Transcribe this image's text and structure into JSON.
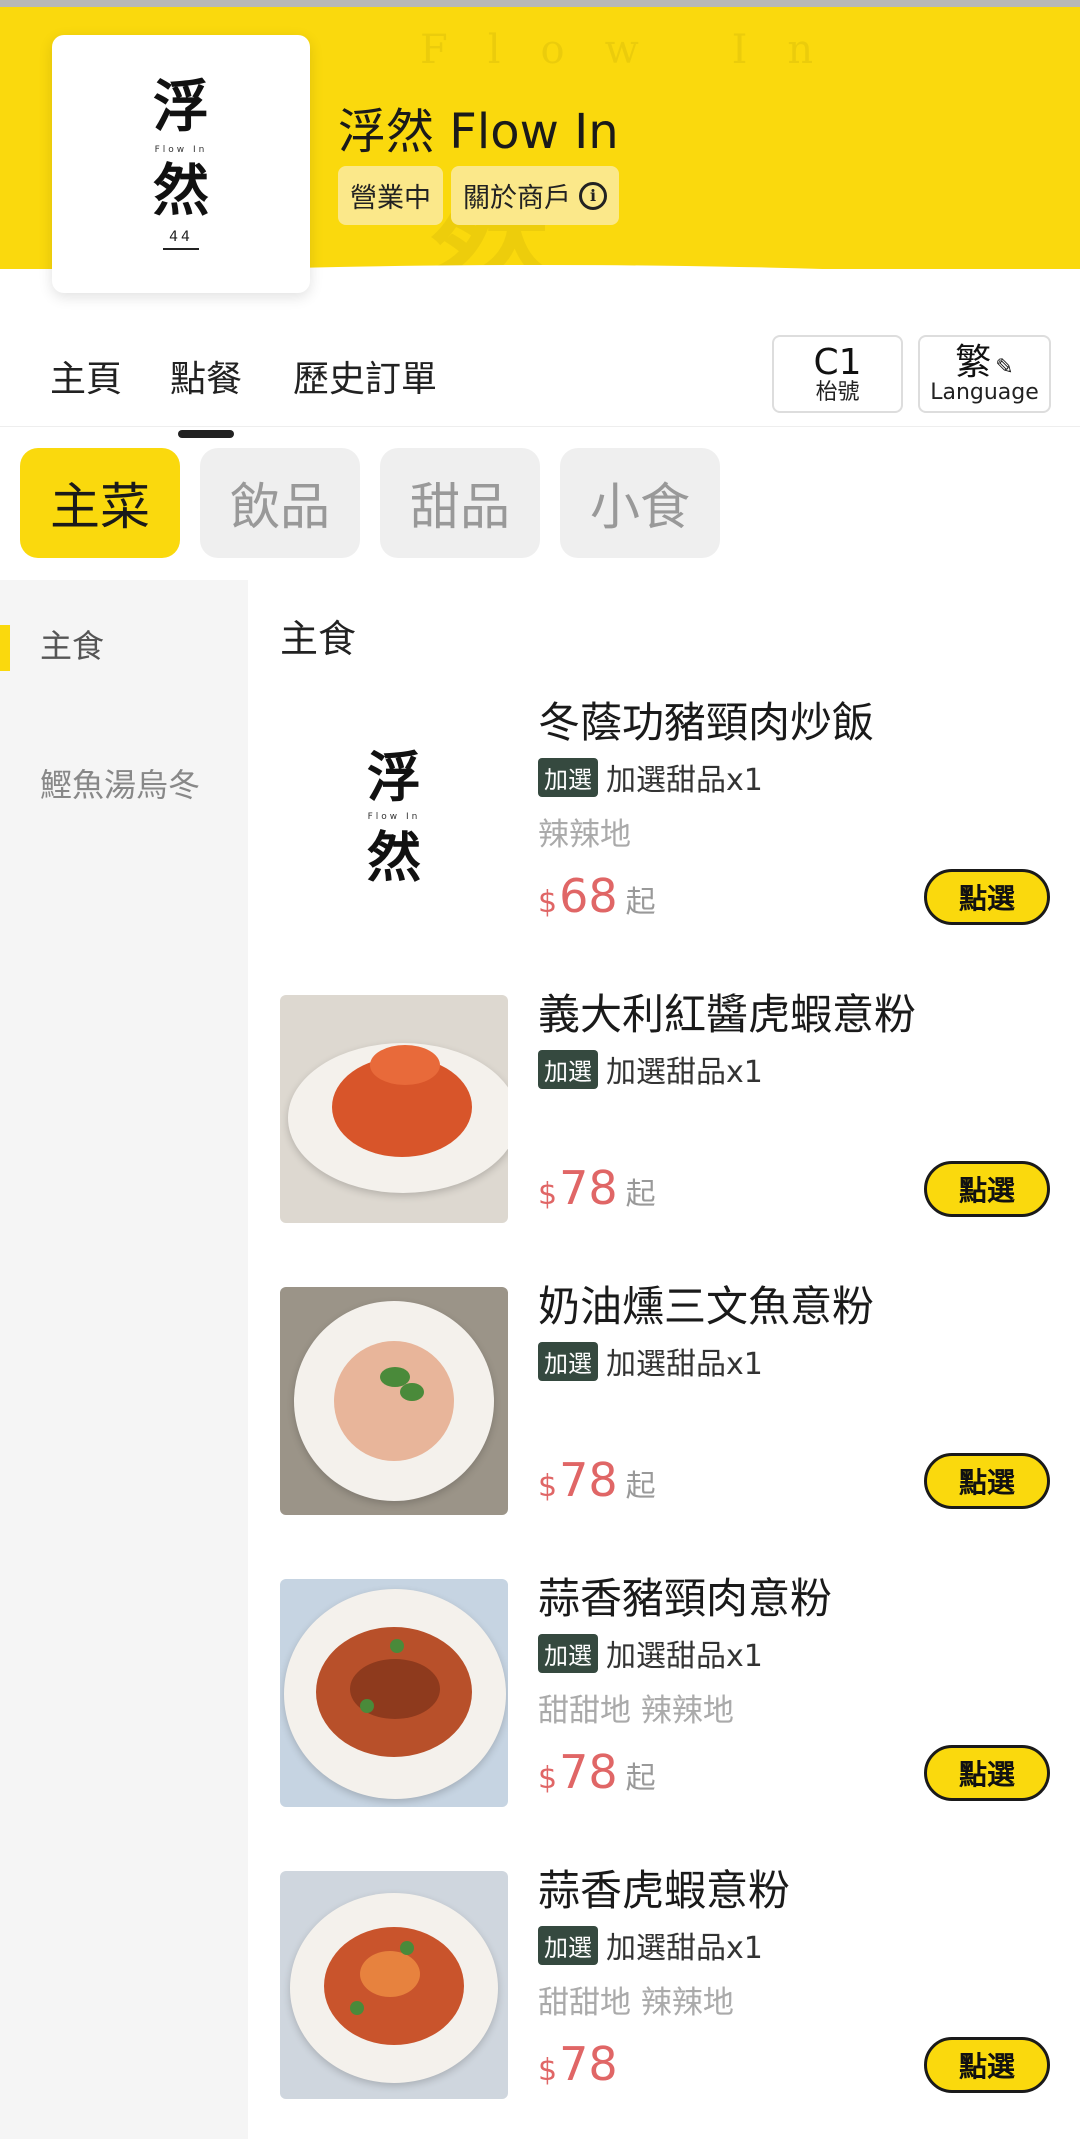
{
  "shop": {
    "name": "浮然 Flow In",
    "status": "營業中",
    "about_label": "關於商戶",
    "logo": {
      "top": "浮",
      "sub": "Flow In",
      "bottom": "然",
      "number": "44"
    }
  },
  "nav": {
    "tabs": [
      {
        "label": "主頁",
        "active": false
      },
      {
        "label": "點餐",
        "active": true
      },
      {
        "label": "歷史訂單",
        "active": false
      }
    ],
    "table": {
      "number": "C1",
      "label": "枱號"
    },
    "language": {
      "current": "繁",
      "label": "Language"
    }
  },
  "categories": [
    {
      "label": "主菜",
      "active": true
    },
    {
      "label": "飲品",
      "active": false
    },
    {
      "label": "甜品",
      "active": false
    },
    {
      "label": "小食",
      "active": false
    }
  ],
  "subnav": [
    {
      "label": "主食",
      "active": true
    },
    {
      "label": "鰹魚湯烏冬",
      "active": false
    }
  ],
  "section_title": "主食",
  "items": [
    {
      "name": "冬蔭功豬頸肉炒飯",
      "addon_tag": "加選",
      "addon": "加選甜品x1",
      "tags": "辣辣地",
      "currency": "$",
      "price": "68",
      "price_suffix": "起",
      "button": "點選",
      "image": "logo"
    },
    {
      "name": "義大利紅醬虎蝦意粉",
      "addon_tag": "加選",
      "addon": "加選甜品x1",
      "tags": "",
      "currency": "$",
      "price": "78",
      "price_suffix": "起",
      "button": "點選",
      "image": "pasta-red-prawn"
    },
    {
      "name": "奶油燻三文魚意粉",
      "addon_tag": "加選",
      "addon": "加選甜品x1",
      "tags": "",
      "currency": "$",
      "price": "78",
      "price_suffix": "起",
      "button": "點選",
      "image": "pasta-cream-salmon"
    },
    {
      "name": "蒜香豬頸肉意粉",
      "addon_tag": "加選",
      "addon": "加選甜品x1",
      "tags": "甜甜地 辣辣地",
      "currency": "$",
      "price": "78",
      "price_suffix": "起",
      "button": "點選",
      "image": "pasta-pork"
    },
    {
      "name": "蒜香虎蝦意粉",
      "addon_tag": "加選",
      "addon": "加選甜品x1",
      "tags": "甜甜地 辣辣地",
      "currency": "$",
      "price": "78",
      "price_suffix": "",
      "button": "點選",
      "image": "pasta-garlic-prawn"
    }
  ],
  "colors": {
    "brand_yellow": "#fad90d",
    "price_red": "#e06666",
    "addon_tag_bg": "#35493f"
  }
}
